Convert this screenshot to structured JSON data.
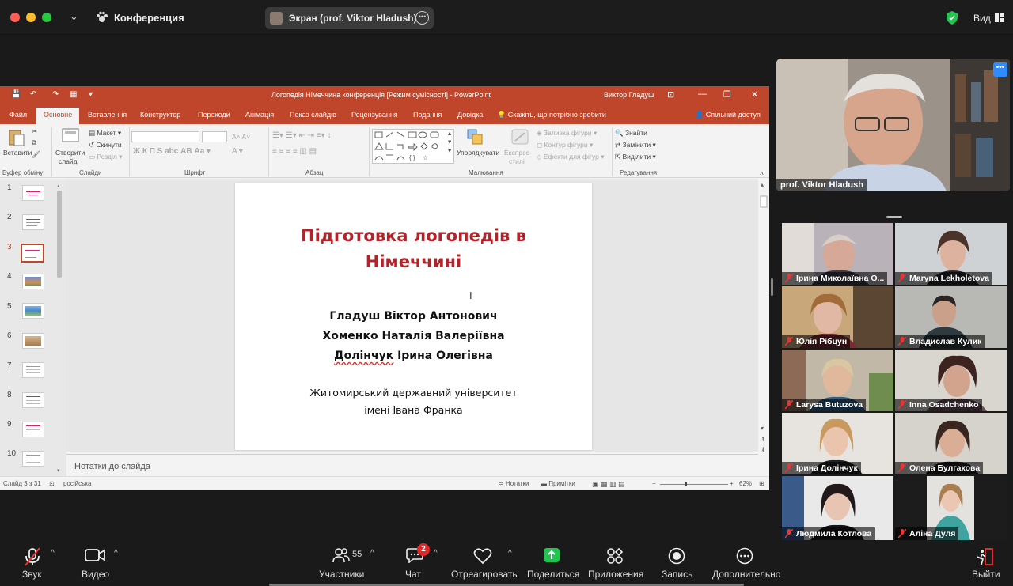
{
  "zoom": {
    "meeting_title": "Конференция",
    "screen_share_label": "Экран (prof. Viktor Hladush)",
    "view_label": "Вид"
  },
  "ppt": {
    "window_title": "Логопедія Німеччина конференція [Режим сумісності]  -  PowerPoint",
    "user": "Виктор Гладуш",
    "tabs": [
      "Файл",
      "Основне",
      "Вставлення",
      "Конструктор",
      "Переходи",
      "Анімація",
      "Показ слайдів",
      "Рецензування",
      "Подання",
      "Довідка"
    ],
    "tell_me": "Скажіть, що потрібно зробити",
    "share": "Спільний доступ",
    "ribbon": {
      "paste": "Вставити",
      "clipboard_group": "Буфер обміну",
      "new_slide_1": "Створити",
      "new_slide_2": "слайд",
      "layout": "Макет",
      "reset": "Скинути",
      "section": "Розділ",
      "slides_group": "Слайди",
      "font_group": "Шрифт",
      "paragraph_group": "Абзац",
      "arrange": "Упорядкувати",
      "quick_styles_1": "Експрес-",
      "quick_styles_2": "стилі",
      "shape_fill": "Заливка фігури",
      "shape_outline": "Контур фігури",
      "shape_effects": "Ефекти для фігур",
      "drawing_group": "Малювання",
      "find": "Знайти",
      "replace": "Замінити",
      "select": "Виділити",
      "editing_group": "Редагування"
    },
    "slide_numbers": [
      "1",
      "2",
      "3",
      "4",
      "5",
      "6",
      "7",
      "8",
      "9",
      "10"
    ],
    "slide": {
      "title_line1": "Підготовка логопедів в",
      "title_line2": "Німеччині",
      "author1": "Гладуш Віктор Антонович",
      "author2": "Хоменко Наталія Валеріївна",
      "author3_surname": "Долінчук",
      "author3_rest": " Ірина Олегівна",
      "uni_line1": "Житомирський державний університет",
      "uni_line2": "імені Івана Франка"
    },
    "notes_placeholder": "Нотатки до слайда",
    "status": {
      "slide_of": "Слайд 3 з 31",
      "language": "російська",
      "notes": "Нотатки",
      "comments": "Примітки",
      "zoom": "62%"
    }
  },
  "participants": {
    "main_speaker": "prof. Viktor Hladush",
    "tiles": [
      "Ірина Миколаївна О...",
      "Maryna Lekholetova",
      "Юлія Рібцун",
      "Владислав Кулик",
      "Larysa Butuzova",
      "Inna Osadchenko",
      "Ірина Долінчук",
      "Олена Булгакова",
      "Людмила Котлова",
      "Аліна Дуля"
    ]
  },
  "toolbar": {
    "audio": "Звук",
    "video": "Видео",
    "participants": "Участники",
    "participants_count": "55",
    "chat": "Чат",
    "chat_badge": "2",
    "react": "Отреагировать",
    "share": "Поделиться",
    "apps": "Приложения",
    "record": "Запись",
    "more": "Дополнительно",
    "leave": "Выйти"
  },
  "colors": {
    "ppt_accent": "#c0462b",
    "slide_title": "#b3232a",
    "zoom_blue": "#2d8cff",
    "share_green": "#23c552",
    "chat_badge": "#e02828"
  }
}
